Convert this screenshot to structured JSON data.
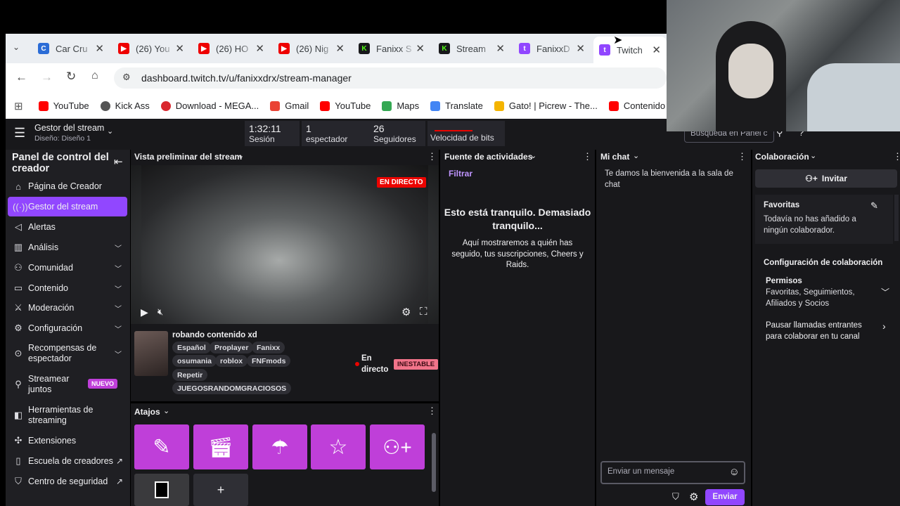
{
  "browser": {
    "tabs": [
      {
        "label": "Car Cru",
        "icon": "car-crushers-icon"
      },
      {
        "label": "(26) You",
        "icon": "youtube-icon"
      },
      {
        "label": "(26) HO",
        "icon": "youtube-icon"
      },
      {
        "label": "(26) Nig",
        "icon": "youtube-icon"
      },
      {
        "label": "Fanixx S",
        "icon": "kick-icon"
      },
      {
        "label": "Stream",
        "icon": "kick-icon"
      },
      {
        "label": "FanixxD",
        "icon": "twitch-icon"
      },
      {
        "label": "Twitch",
        "icon": "twitch-icon"
      }
    ],
    "url": "dashboard.twitch.tv/u/fanixxdrx/stream-manager",
    "bookmarks": [
      {
        "label": "YouTube",
        "color": "#ff0000"
      },
      {
        "label": "Kick Ass",
        "color": "#555555"
      },
      {
        "label": "Download - MEGA...",
        "color": "#d9272e"
      },
      {
        "label": "Gmail",
        "color": "#ea4335"
      },
      {
        "label": "YouTube",
        "color": "#ff0000"
      },
      {
        "label": "Maps",
        "color": "#34a853"
      },
      {
        "label": "Translate",
        "color": "#4285f4"
      },
      {
        "label": "Gato! | Picrew - The...",
        "color": "#f4b400"
      },
      {
        "label": "Contenido del c",
        "color": "#ff0000"
      }
    ]
  },
  "topnav": {
    "title": "Gestor del stream",
    "subtitle": "Diseño: Diseño 1",
    "stats": [
      {
        "value": "1:32:11",
        "label": "Sesión"
      },
      {
        "value": "1",
        "label": "espectador"
      },
      {
        "value": "26",
        "label": "Seguidores"
      },
      {
        "value": "",
        "label": "Velocidad de bits"
      }
    ],
    "search_placeholder": "Búsqueda en Panel c"
  },
  "sidebar": {
    "title": "Panel de control del creador",
    "items": [
      {
        "label": "Página de Creador",
        "icon": "home-icon"
      },
      {
        "label": "Gestor del stream",
        "icon": "broadcast-icon"
      },
      {
        "label": "Alertas",
        "icon": "megaphone-icon"
      },
      {
        "label": "Análisis",
        "icon": "chart-icon"
      },
      {
        "label": "Comunidad",
        "icon": "people-icon"
      },
      {
        "label": "Contenido",
        "icon": "content-icon"
      },
      {
        "label": "Moderación",
        "icon": "sword-icon"
      },
      {
        "label": "Configuración",
        "icon": "gear-icon"
      },
      {
        "label": "Recompensas de espectador",
        "icon": "reward-icon"
      },
      {
        "label": "Streamear juntos",
        "icon": "add-person-icon"
      },
      {
        "label": "Herramientas de streaming",
        "icon": "tools-icon"
      },
      {
        "label": "Extensiones",
        "icon": "puzzle-icon"
      },
      {
        "label": "Escuela de creadores",
        "icon": "book-icon"
      },
      {
        "label": "Centro de seguridad",
        "icon": "shield-icon"
      }
    ],
    "nuevo_badge": "NUEVO"
  },
  "preview": {
    "header": "Vista preliminar del stream",
    "live_badge": "EN DIRECTO",
    "stream_title": "robando contenido xd",
    "tags": [
      "Español",
      "Proplayer",
      "Fanixx",
      "osumania",
      "roblox",
      "FNFmods",
      "Repetir",
      "JUEGOSRANDOMGRACIOSOS"
    ],
    "live_status": "En directo",
    "connection_badge": "INESTABLE"
  },
  "shortcuts": {
    "header": "Atajos"
  },
  "activity": {
    "header": "Fuente de actividades",
    "filter": "Filtrar",
    "empty_title": "Esto está tranquilo. Demasiado tranquilo...",
    "empty_body": "Aquí mostraremos a quién has seguido, tus suscripciones, Cheers y Raids."
  },
  "chat": {
    "header": "Mi chat",
    "welcome": "Te damos la bienvenida a la sala de chat",
    "input_placeholder": "Enviar un mensaje",
    "send": "Enviar"
  },
  "collab": {
    "header": "Colaboración",
    "invite": "Invitar",
    "favorites_title": "Favoritas",
    "favorites_body": "Todavía no has añadido a ningún colaborador.",
    "config_title": "Configuración de colaboración",
    "permissions_title": "Permisos",
    "permissions_body": "Favoritas, Seguimientos, Afiliados y Socios",
    "pause_calls": "Pausar llamadas entrantes para colaborar en tu canal"
  },
  "colors": {
    "accent": "#9147ff",
    "shortcut": "#bf3fd9",
    "live": "#eb0400"
  }
}
